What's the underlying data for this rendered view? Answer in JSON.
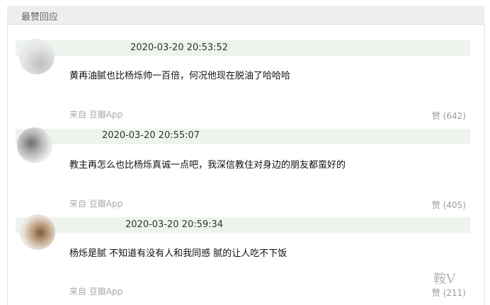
{
  "section_title": "最赞回应",
  "comments": [
    {
      "timestamp": "2020-03-20 20:53:52",
      "text": "黄再油腻也比杨烁帅一百倍，何况他现在脱油了哈哈哈",
      "source": "来自 豆瓣App",
      "likes": "赞 (642)"
    },
    {
      "timestamp": "2020-03-20 20:55:07",
      "text": "教主再怎么也比杨烁真诚一点吧，我深信教住对身边的朋友都蛮好的",
      "source": "来自 豆瓣App",
      "likes": "赞 (405)"
    },
    {
      "timestamp": "2020-03-20 20:59:34",
      "text": "杨烁是腻 不知道有没有人和我同感 腻的让人吃不下饭",
      "source": "来自 豆瓣App",
      "likes": "赞 (211)"
    }
  ],
  "watermark": "鞍V"
}
